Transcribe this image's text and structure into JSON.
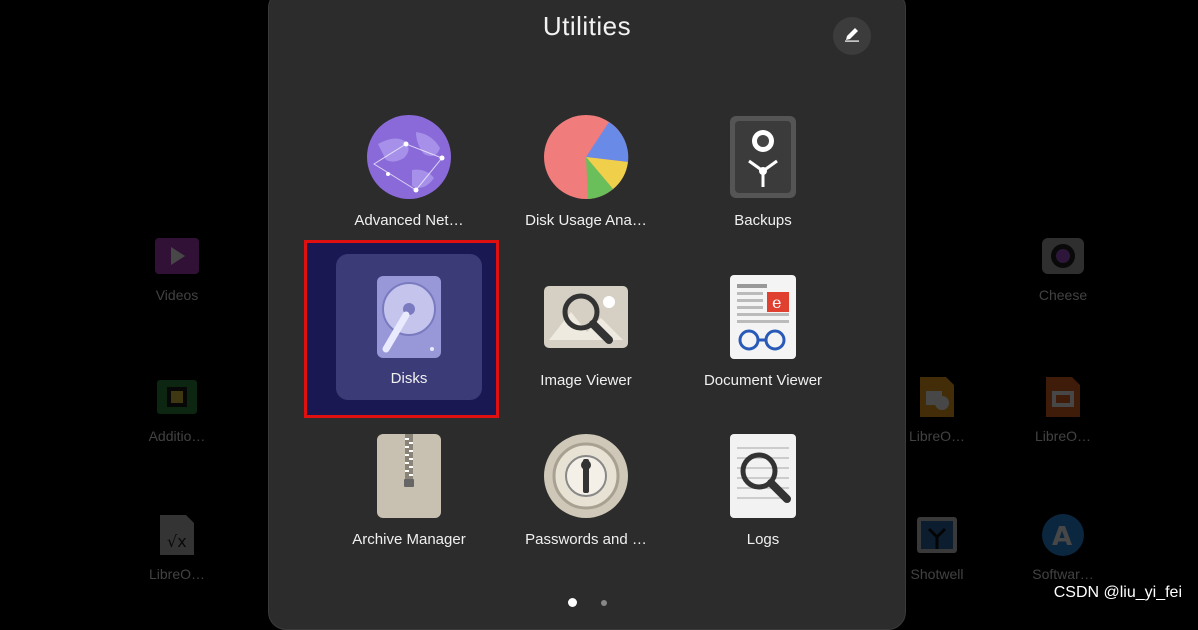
{
  "background_apps": [
    {
      "label": "Videos"
    },
    {
      "label": "Cheese"
    },
    {
      "label": "Additio…"
    },
    {
      "label": "LibreO…"
    },
    {
      "label": "LibreO…"
    },
    {
      "label": "LibreO…"
    },
    {
      "label": "Shotwell"
    },
    {
      "label": "Softwar…"
    }
  ],
  "folder": {
    "title": "Utilities",
    "edit_icon": "pencil-edit-icon",
    "apps": [
      {
        "label": "Advanced Net…",
        "icon": "network-globe-icon"
      },
      {
        "label": "Disk Usage Ana…",
        "icon": "pie-chart-icon"
      },
      {
        "label": "Backups",
        "icon": "safe-icon"
      },
      {
        "label": "Disks",
        "icon": "hard-disk-icon",
        "selected": true
      },
      {
        "label": "Image Viewer",
        "icon": "magnifier-photo-icon"
      },
      {
        "label": "Document Viewer",
        "icon": "document-glasses-icon"
      },
      {
        "label": "Archive Manager",
        "icon": "archive-zipper-icon"
      },
      {
        "label": "Passwords and …",
        "icon": "keyhole-icon"
      },
      {
        "label": "Logs",
        "icon": "log-magnifier-icon"
      }
    ],
    "pages": {
      "count": 2,
      "current": 1
    }
  },
  "watermark": "CSDN @liu_yi_fei",
  "colors": {
    "highlight_border": "#e01010",
    "selected_tile": "#3b3b78",
    "panel": "#2c2c2c"
  }
}
